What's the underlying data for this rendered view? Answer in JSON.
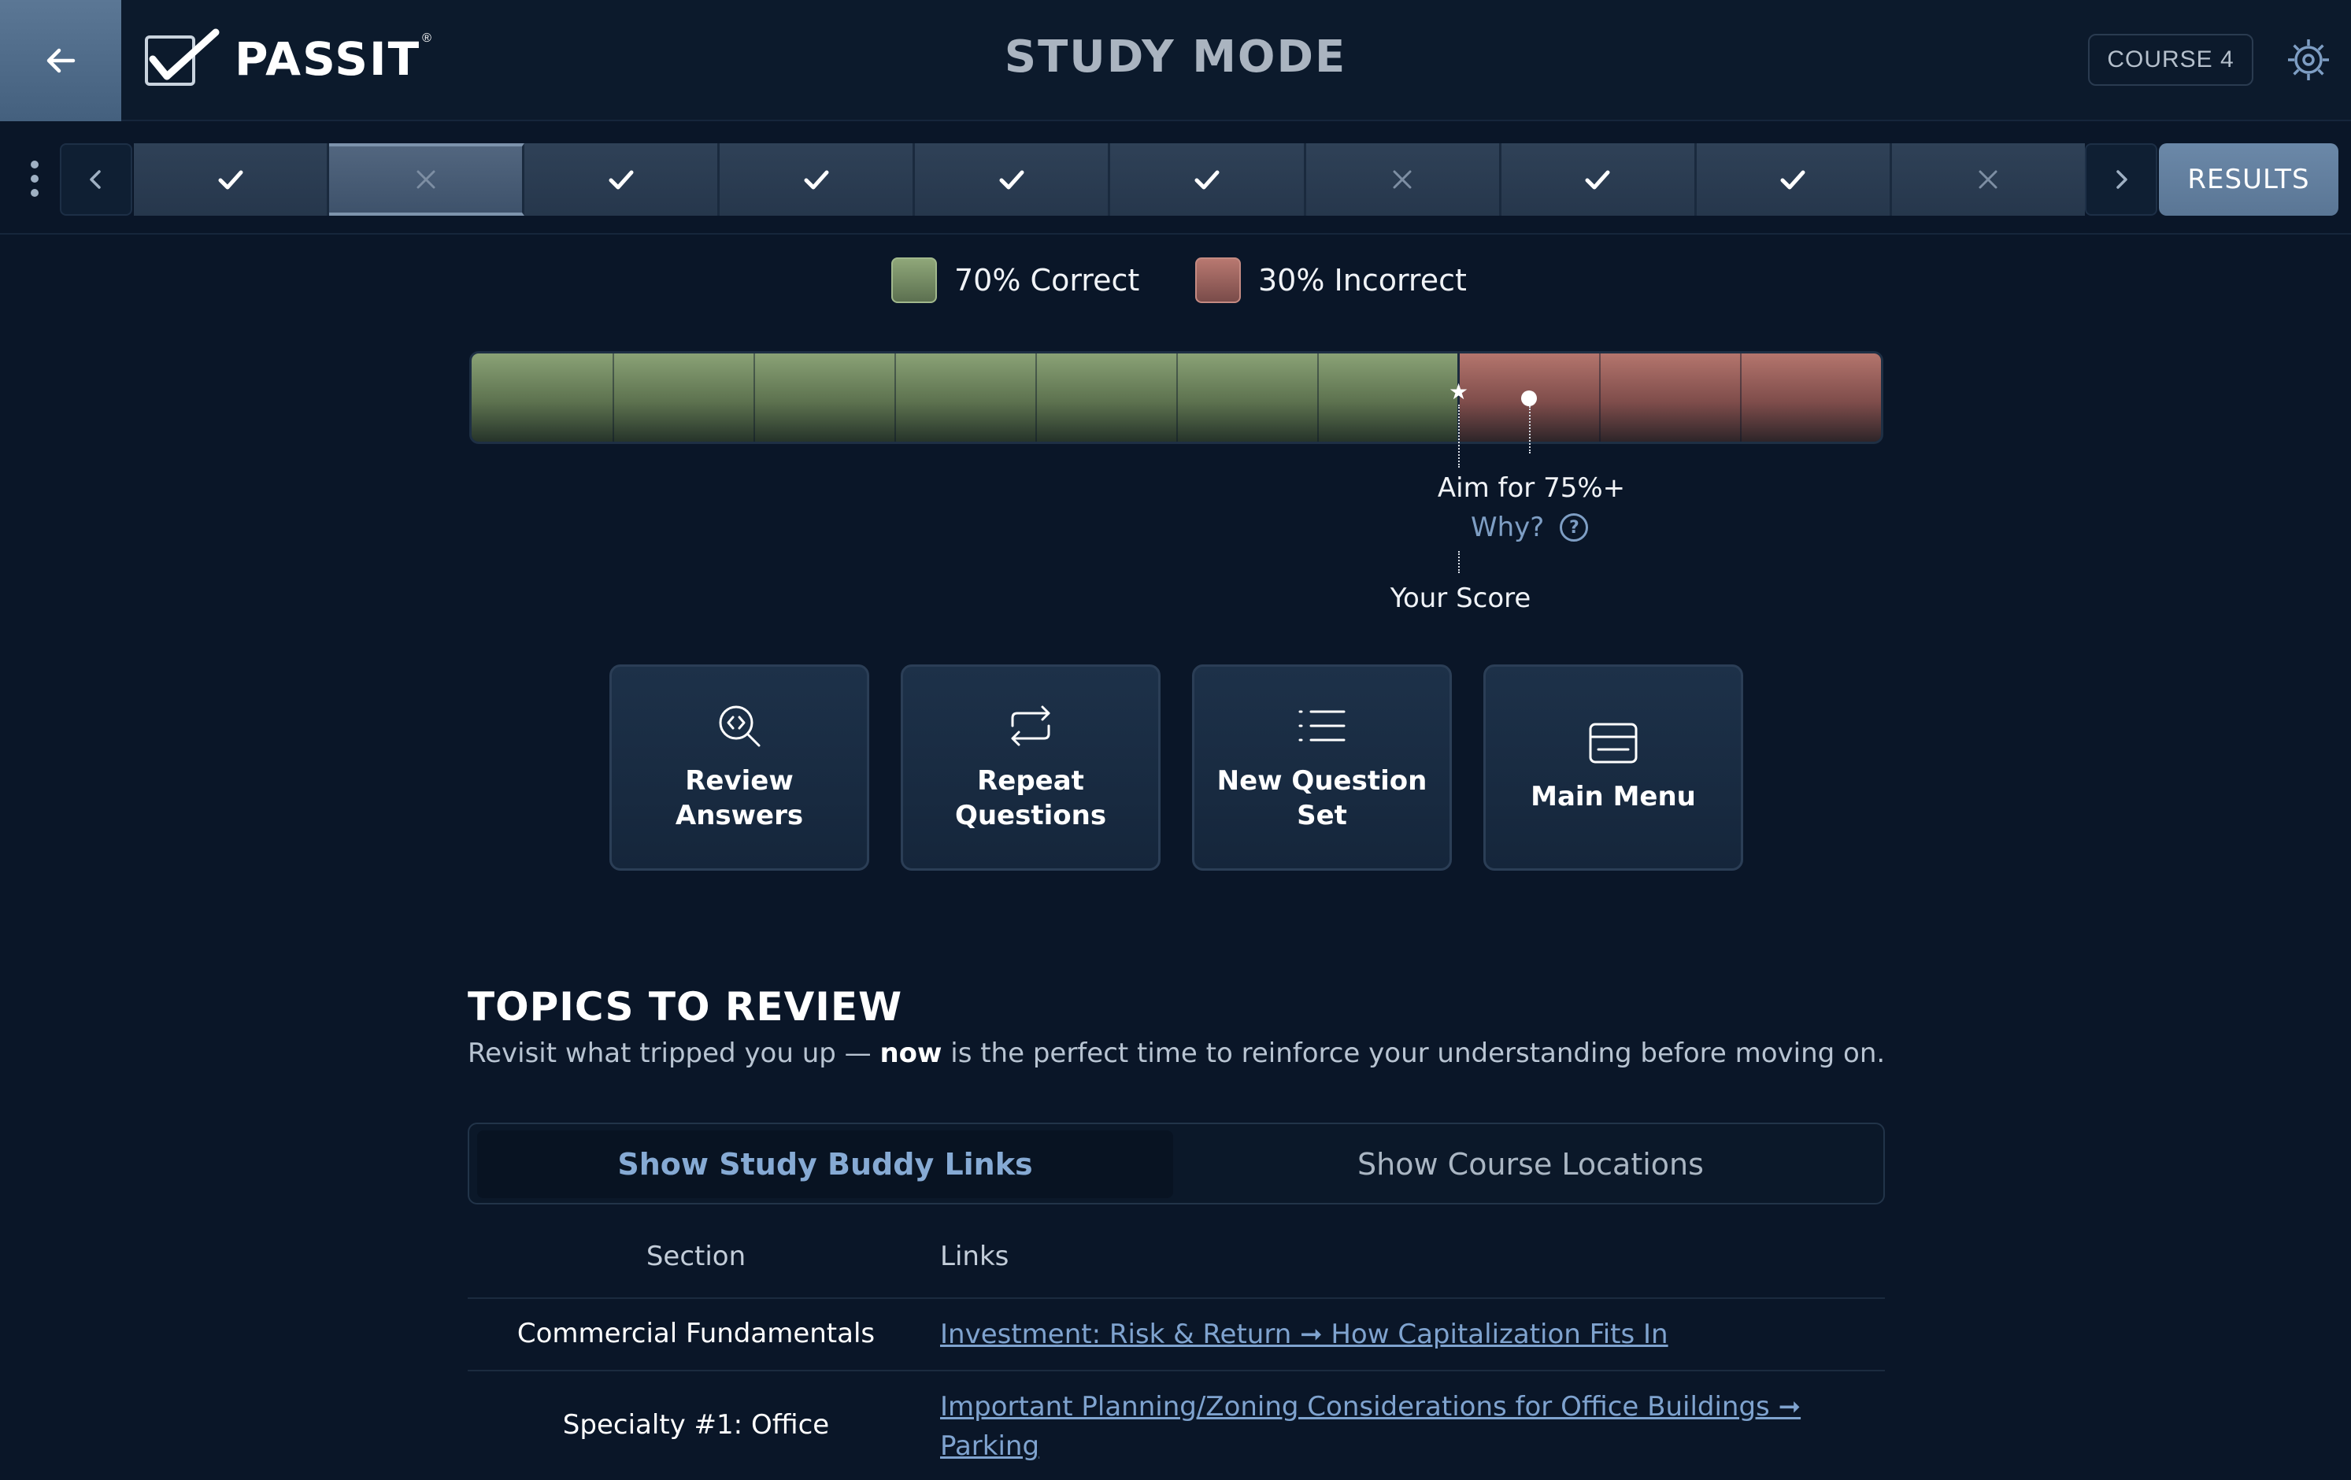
{
  "header": {
    "logo_text": "PASSIT",
    "logo_mark": "®",
    "title": "STUDY MODE",
    "course_badge": "COURSE 4"
  },
  "question_nav": {
    "results_label": "RESULTS",
    "active_index": 1,
    "questions": [
      {
        "status": "correct",
        "icon": "check-icon"
      },
      {
        "status": "incorrect",
        "icon": "x-icon"
      },
      {
        "status": "correct",
        "icon": "check-icon"
      },
      {
        "status": "correct",
        "icon": "check-icon"
      },
      {
        "status": "correct",
        "icon": "check-icon"
      },
      {
        "status": "correct",
        "icon": "check-icon"
      },
      {
        "status": "incorrect",
        "icon": "x-icon"
      },
      {
        "status": "correct",
        "icon": "check-icon"
      },
      {
        "status": "correct",
        "icon": "check-icon"
      },
      {
        "status": "incorrect",
        "icon": "x-icon"
      }
    ]
  },
  "score": {
    "correct_label": "70% Correct",
    "incorrect_label": "30% Incorrect",
    "correct_percent": 70,
    "target_percent": 75,
    "aim_label": "Aim for 75%+",
    "why_label": "Why?",
    "your_score_label": "Your Score",
    "colors": {
      "correct": "#8aa276",
      "incorrect": "#b4756d"
    }
  },
  "actions": [
    {
      "label": "Review Answers",
      "icon": "review-search-icon"
    },
    {
      "label": "Repeat Questions",
      "icon": "repeat-icon"
    },
    {
      "label": "New Question Set",
      "icon": "list-icon"
    },
    {
      "label": "Main Menu",
      "icon": "menu-card-icon"
    }
  ],
  "topics": {
    "title": "TOPICS TO REVIEW",
    "subtitle_before": "Revisit what tripped you up — ",
    "subtitle_bold": "now",
    "subtitle_after": " is the perfect time to reinforce your understanding before moving on.",
    "toggle_on": "Show Study Buddy Links",
    "toggle_off": "Show Course Locations",
    "col_section": "Section",
    "col_links": "Links",
    "rows": [
      {
        "section": "Commercial Fundamentals",
        "link": "Investment: Risk & Return ➞ How Capitalization Fits In"
      },
      {
        "section": "Specialty #1: Office",
        "link": "Important Planning/Zoning Considerations for Office Buildings ➞ Parking"
      }
    ]
  }
}
